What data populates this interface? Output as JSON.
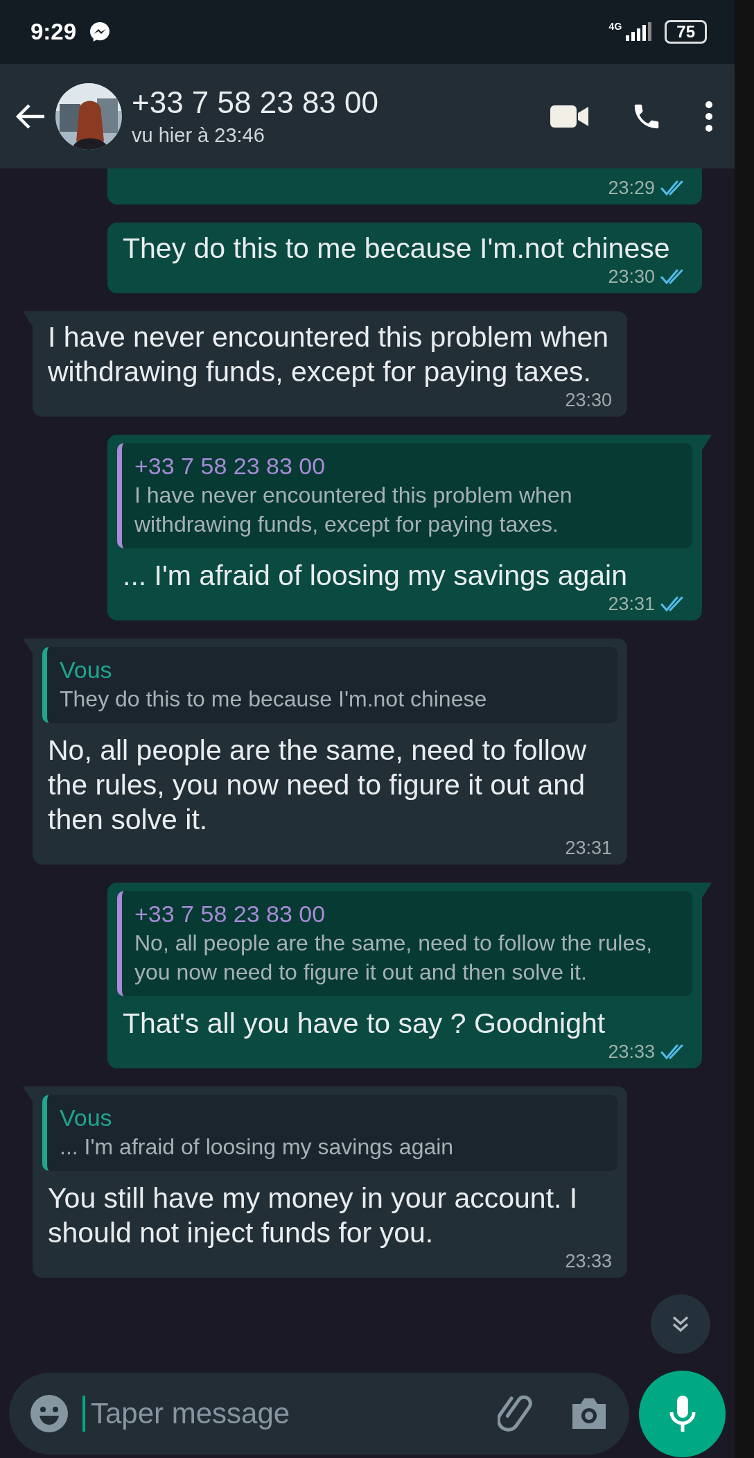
{
  "status_bar": {
    "time": "9:29",
    "network": "4G",
    "battery": "75"
  },
  "header": {
    "title": "+33 7 58 23 83 00",
    "subtitle": "vu hier à 23:46"
  },
  "messages": [
    {
      "kind": "outgoing",
      "tail": false,
      "time": "23:29",
      "read": true
    },
    {
      "kind": "outgoing",
      "tail": false,
      "text": "They do this to me because I'm.not chinese",
      "time": "23:30",
      "read": true
    },
    {
      "kind": "incoming",
      "tail": true,
      "text": "I have never encountered this problem when withdrawing funds, except for paying taxes.",
      "time": "23:30"
    },
    {
      "kind": "outgoing",
      "tail": true,
      "quote": {
        "author": "+33 7 58 23 83 00",
        "color": "#a78bd8",
        "text": "I have never encountered this problem when withdrawing funds, except for paying taxes."
      },
      "text": "... I'm afraid of loosing my savings again",
      "time": "23:31",
      "read": true
    },
    {
      "kind": "incoming",
      "tail": true,
      "quote": {
        "author": "Vous",
        "color": "#1fa68c",
        "text": "They do this to me because I'm.not chinese"
      },
      "text": "No, all people are the same, need to follow the rules, you now need to figure it out and then solve it.",
      "time": "23:31"
    },
    {
      "kind": "outgoing",
      "tail": true,
      "quote": {
        "author": "+33 7 58 23 83 00",
        "color": "#a78bd8",
        "text": "No, all people are the same, need to follow the rules, you now need to figure it out and then solve it."
      },
      "text": "That's all you have to say ? Goodnight",
      "time": "23:33",
      "read": true
    },
    {
      "kind": "incoming",
      "tail": true,
      "quote": {
        "author": "Vous",
        "color": "#1fa68c",
        "text": "... I'm afraid of loosing my savings again"
      },
      "text": "You still have my money in your account. I should not inject funds for you.",
      "time": "23:33"
    }
  ],
  "composer": {
    "placeholder": "Taper message"
  }
}
